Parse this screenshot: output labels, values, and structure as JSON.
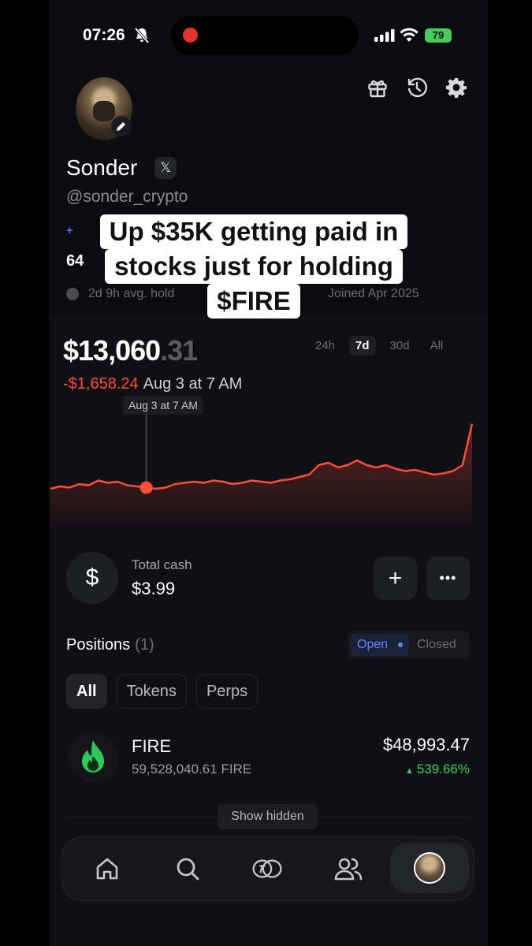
{
  "status": {
    "time": "07:26",
    "battery": "79"
  },
  "profile": {
    "name": "Sonder",
    "x_badge": "𝕏",
    "handle": "@sonder_crypto",
    "line_peek": "+",
    "stat_peek": "64",
    "hold": "2d 9h avg. hold",
    "joined": "Joined Apr 2025"
  },
  "caption": {
    "line1": "Up $35K getting paid in",
    "line2": "stocks just for holding",
    "line3": "$FIRE"
  },
  "portfolio": {
    "balance_main": "$13,060",
    "balance_cents": ".31",
    "change": "-$1,658.24",
    "change_time": "Aug 3 at 7 AM",
    "tooltip": "Aug 3 at 7 AM",
    "ranges": [
      "24h",
      "7d",
      "30d",
      "All"
    ],
    "selected_range": "7d"
  },
  "chart_data": {
    "type": "line",
    "color": "#ff4d3a",
    "note_values": [
      0.4,
      0.42,
      0.41,
      0.44,
      0.43,
      0.47,
      0.45,
      0.46,
      0.43,
      0.42,
      0.41,
      0.4,
      0.41,
      0.44,
      0.45,
      0.46,
      0.45,
      0.47,
      0.46,
      0.44,
      0.45,
      0.47,
      0.46,
      0.45,
      0.47,
      0.48,
      0.5,
      0.52,
      0.6,
      0.62,
      0.58,
      0.6,
      0.64,
      0.6,
      0.58,
      0.6,
      0.57,
      0.55,
      0.56,
      0.54,
      0.52,
      0.53,
      0.55,
      0.6,
      0.95
    ],
    "highlight_index": 10
  },
  "cash": {
    "icon": "$",
    "label": "Total cash",
    "value": "$3.99",
    "add": "+",
    "more": "•••"
  },
  "positions": {
    "title": "Positions",
    "count": "(1)",
    "open": "Open",
    "closed": "Closed",
    "filters": [
      "All",
      "Tokens",
      "Perps"
    ],
    "items": [
      {
        "name": "FIRE",
        "qty": "59,528,040.61 FIRE",
        "value": "$48,993.47",
        "pct": "539.66%"
      }
    ],
    "show_hidden": "Show hidden"
  },
  "nav": {
    "icons": [
      "home-icon",
      "search-icon",
      "tokens-icon",
      "friends-icon",
      "profile-avatar"
    ]
  },
  "colors": {
    "accent_blue": "#5d82ff",
    "negative": "#ff4d3a",
    "positive": "#3fd05a"
  }
}
